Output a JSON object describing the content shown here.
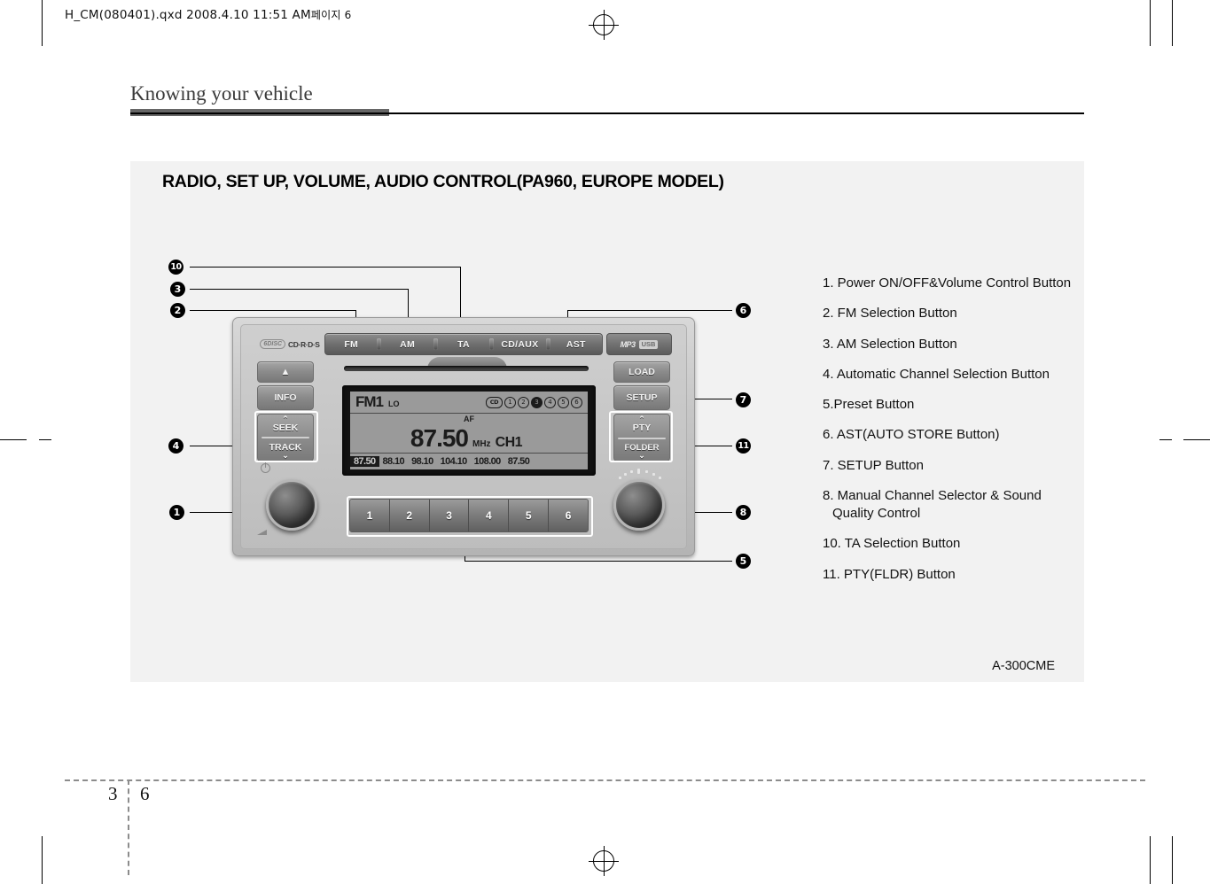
{
  "header": {
    "file_stamp": "H_CM(080401).qxd  2008.4.10  11:51 AM",
    "file_stamp_kr": "페이지 6"
  },
  "running_head": {
    "title": "Knowing your vehicle"
  },
  "figure": {
    "title": "RADIO, SET UP, VOLUME, AUDIO CONTROL(PA960, EUROPE MODEL)",
    "figure_id": "A-300CME"
  },
  "legend": {
    "items": [
      "1. Power ON/OFF&Volume Control Button",
      "2. FM Selection Button",
      "3. AM Selection Button",
      "4. Automatic Channel Selection Button",
      "5.Preset Button",
      "6. AST(AUTO STORE Button)",
      "7. SETUP Button",
      "8. Manual Channel Selector & Sound",
      "Quality Control",
      "10. TA Selection Button",
      "11. PTY(FLDR) Button"
    ]
  },
  "callouts": {
    "left": [
      "10",
      "3",
      "2",
      "4",
      "1"
    ],
    "right": [
      "6",
      "7",
      "11",
      "8",
      "5"
    ]
  },
  "head_unit": {
    "brand_left_disc": "6DISC",
    "brand_left_cdrds": "CD·R·D·S",
    "source_buttons": [
      "FM",
      "AM",
      "TA",
      "CD/AUX",
      "AST"
    ],
    "brand_right_mp3": "MP3",
    "brand_right_usb": "USB",
    "left_buttons": {
      "eject": "▲",
      "info": "INFO",
      "rocker_up_arrow": "⌃",
      "rocker_up": "SEEK",
      "rocker_down": "TRACK",
      "rocker_down_arrow": "⌄"
    },
    "right_buttons": {
      "load": "LOAD",
      "setup": "SETUP",
      "rocker_up_arrow": "⌃",
      "rocker_up": "PTY",
      "rocker_down": "FOLDER",
      "rocker_down_arrow": "⌄"
    },
    "preset_buttons": [
      "1",
      "2",
      "3",
      "4",
      "5",
      "6"
    ],
    "display": {
      "band": "FM1",
      "lo": "LO",
      "cd_indicator": "CD",
      "preset_indicators": [
        "1",
        "2",
        "3",
        "4",
        "5",
        "6"
      ],
      "active_preset_indicator": "3",
      "af": "AF",
      "frequency": "87.50",
      "unit": "MHz",
      "channel": "CH1",
      "preset_frequencies": [
        "87.50",
        "88.10",
        "98.10",
        "104.10",
        "108.00",
        "87.50"
      ],
      "selected_preset_frequency": "87.50"
    }
  },
  "footer": {
    "chapter": "3",
    "page": "6"
  }
}
